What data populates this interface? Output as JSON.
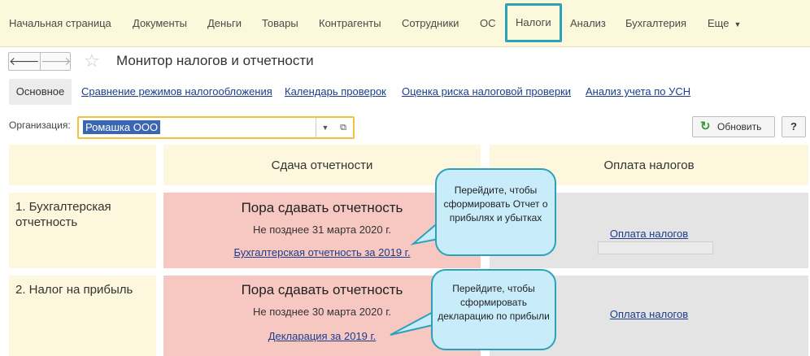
{
  "menu": {
    "items": [
      "Начальная страница",
      "Документы",
      "Деньги",
      "Товары",
      "Контрагенты",
      "Сотрудники",
      "ОС",
      "Налоги",
      "Анализ",
      "Бухгалтерия",
      "Еще"
    ],
    "active": "Налоги"
  },
  "title": "Монитор налогов и отчетности",
  "tabs": {
    "main": "Основное",
    "links": [
      "Сравнение режимов налогообложения",
      "Календарь проверок",
      "Оценка риска налоговой проверки",
      "Анализ учета по УСН"
    ]
  },
  "org": {
    "label": "Организация:",
    "value": "Ромашка ООО"
  },
  "buttons": {
    "refresh": "Обновить",
    "help": "?"
  },
  "columns": {
    "reporting": "Сдача отчетности",
    "payment": "Оплата налогов"
  },
  "rows": [
    {
      "label": "1. Бухгалтерская отчетность",
      "status": "Пора сдавать отчетность",
      "deadline": "Не позднее 31 марта 2020 г.",
      "report_link": "Бухгалтерская отчетность за 2019 г.",
      "pay_link": "Оплата налогов"
    },
    {
      "label": "2. Налог на прибыль",
      "status": "Пора сдавать отчетность",
      "deadline": "Не позднее 30 марта 2020 г.",
      "report_link": "Декларация за  2019 г.",
      "pay_link": "Оплата налогов"
    }
  ],
  "callouts": [
    "Перейдите, чтобы сформировать Отчет о прибылях и убытках",
    "Перейдите, чтобы сформировать декларацию по прибыли"
  ],
  "colors": {
    "menu_bg": "#fbf8dc",
    "active_border": "#2aa3ba",
    "link": "#1a3e8c",
    "overdue_bg": "#f7c8c2",
    "neutral_bg": "#e4e4e4",
    "header_bg": "#fdf8dd",
    "callout_bg": "#c9ecfb",
    "org_border": "#f0c23d"
  }
}
